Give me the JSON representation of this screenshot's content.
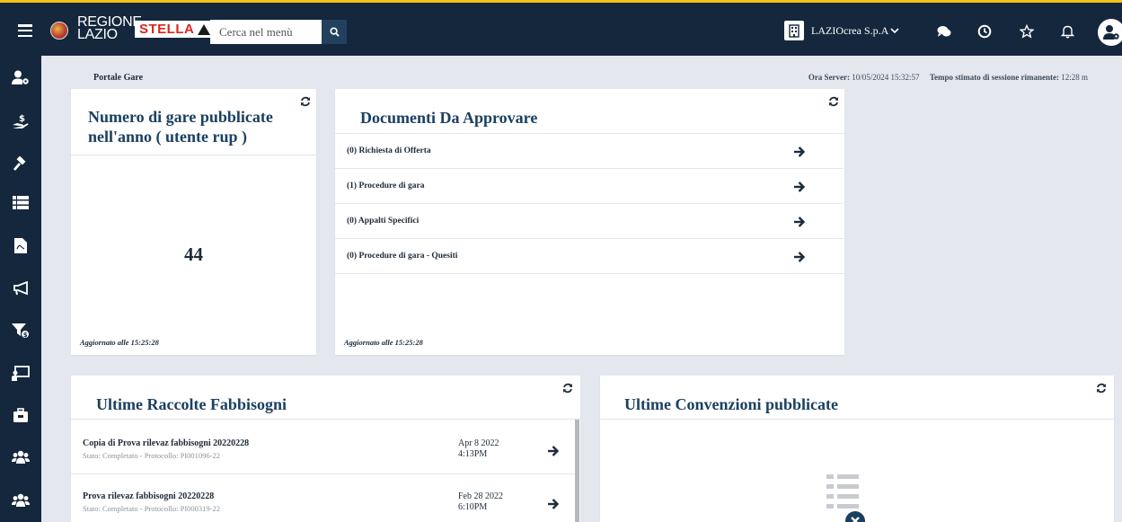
{
  "header": {
    "logo_line1": "REGIONE",
    "logo_line2": "LAZIO",
    "brand": "STELLA",
    "search_placeholder": "Cerca nel menù",
    "company": "LAZIOcrea S.p.A"
  },
  "icons": {
    "menu": "hamburger-icon",
    "search": "search-icon",
    "company": "building-icon",
    "company_dropdown": "chevron-down-icon",
    "chat": "chat-icon",
    "history": "clock-icon",
    "favorites": "star-icon",
    "notifications": "bell-icon",
    "user": "user-settings-icon"
  },
  "sidebar": {
    "items": [
      "user-settings-icon",
      "hand-money-icon",
      "gavel-icon",
      "list-icon",
      "pdf-document-icon",
      "megaphone-icon",
      "filter-money-icon",
      "presentation-icon",
      "briefcase-icon",
      "users-icon",
      "users-icon"
    ]
  },
  "breadcrumb": "Portale Gare",
  "server": {
    "time_label": "Ora Server:",
    "time_value": "10/05/2024 15:32:57",
    "session_label": "Tempo stimato di sessione rimanente:",
    "session_value": "12:28 m"
  },
  "gare_card": {
    "title_line1": "Numero di gare pubblicate",
    "title_line2": "nell'anno ( utente rup )",
    "value": "44",
    "updated": "Aggiornato alle 15:25:28"
  },
  "documents_card": {
    "title": "Documenti Da Approvare",
    "rows": [
      "(0) Richiesta di Offerta",
      "(1) Procedure di gara",
      "(0) Appalti Specifici",
      "(0) Procedure di gara - Quesiti"
    ],
    "updated": "Aggiornato alle 15:25:28"
  },
  "fabbisogni_card": {
    "title": "Ultime Raccolte Fabbisogni",
    "rows": [
      {
        "title": "Copia di Prova rilevaz fabbisogni 20220228",
        "status": "Stato: Completato - Protocollo: PI001096-22",
        "date": "Apr 8 2022",
        "time": "4:13PM"
      },
      {
        "title": "Prova rilevaz fabbisogni 20220228",
        "status": "Stato: Completato - Protocollo: PI000319-22",
        "date": "Feb 28 2022",
        "time": "6:10PM"
      }
    ]
  },
  "convenzioni_card": {
    "title": "Ultime Convenzioni pubblicate",
    "empty_icon": "empty-list-icon"
  },
  "colors": {
    "topbar": "#14273d",
    "accent_border": "#f2c319",
    "title": "#1b4060",
    "background": "#e4e8ee"
  }
}
